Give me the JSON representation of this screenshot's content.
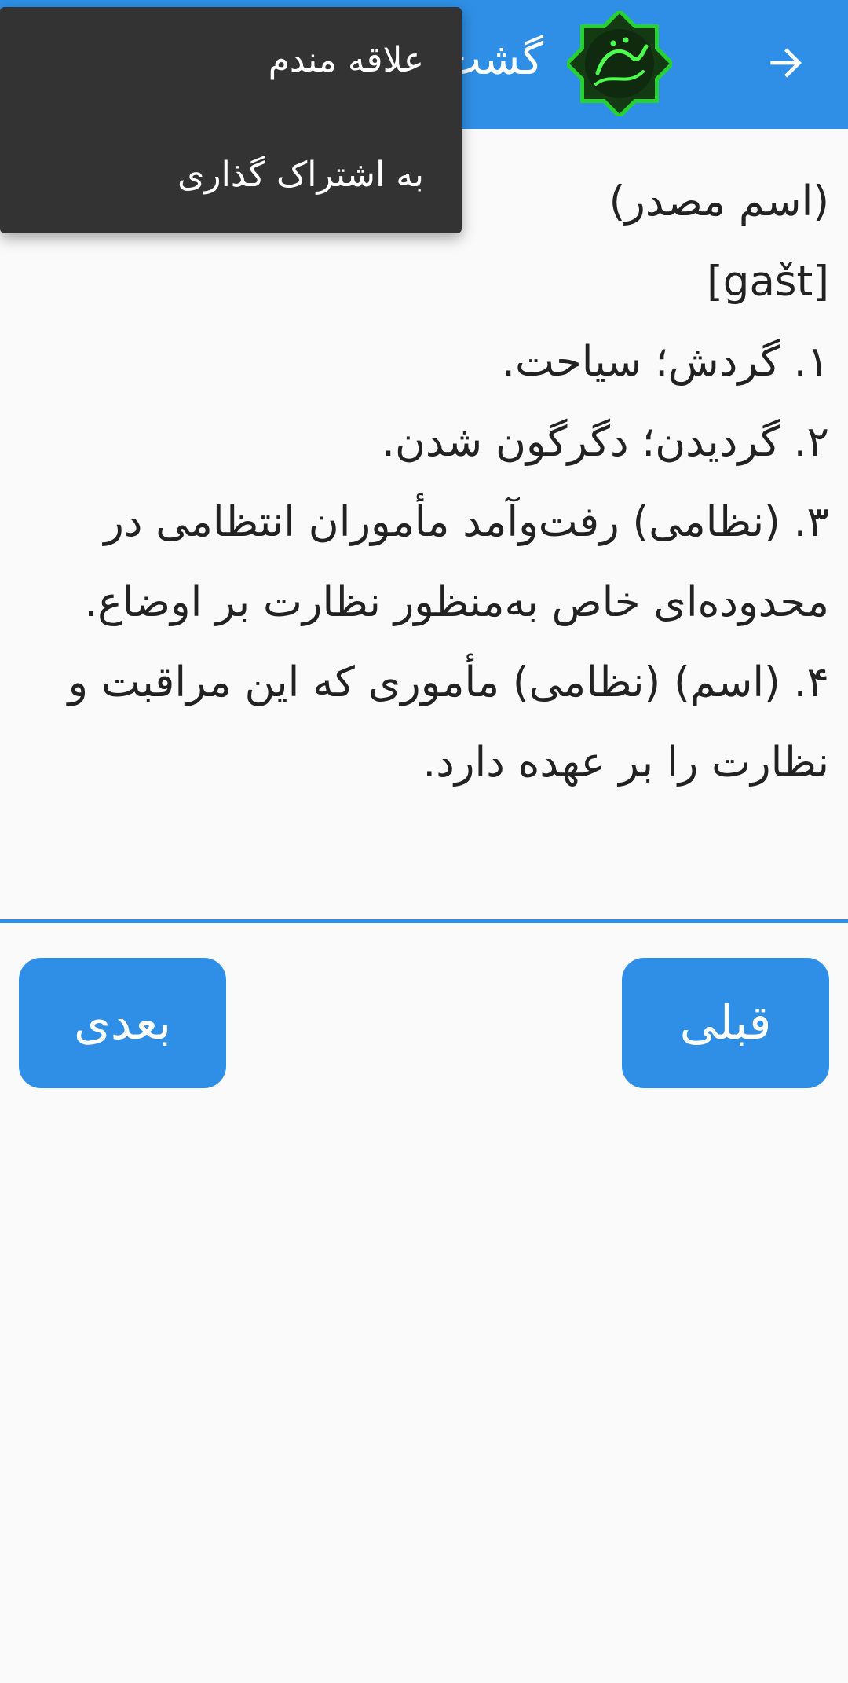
{
  "app_bar": {
    "title": "گشت",
    "back_icon": "arrow-right-icon",
    "logo_icon": "farhang-amid-logo-icon",
    "background_color": "#2f8fe6"
  },
  "definition": {
    "lines": [
      "(اسم مصدر)",
      "[gašt]",
      "۱. گردش؛ سیاحت.",
      "۲. گردیدن؛ دگرگون شدن.",
      "۳. (نظامی) رفت‌وآمد مأموران انتظامی در",
      "محدوده‌ای خاص به‌منظور نظارت بر اوضاع.",
      "۴. (اسم) (نظامی) مأموری که این مراقبت و",
      "نظارت را بر عهده دارد."
    ]
  },
  "navigation": {
    "prev_label": "قبلی",
    "next_label": "بعدی"
  },
  "menu": {
    "items": [
      "علاقه مندم",
      "به اشتراک گذاری"
    ]
  }
}
